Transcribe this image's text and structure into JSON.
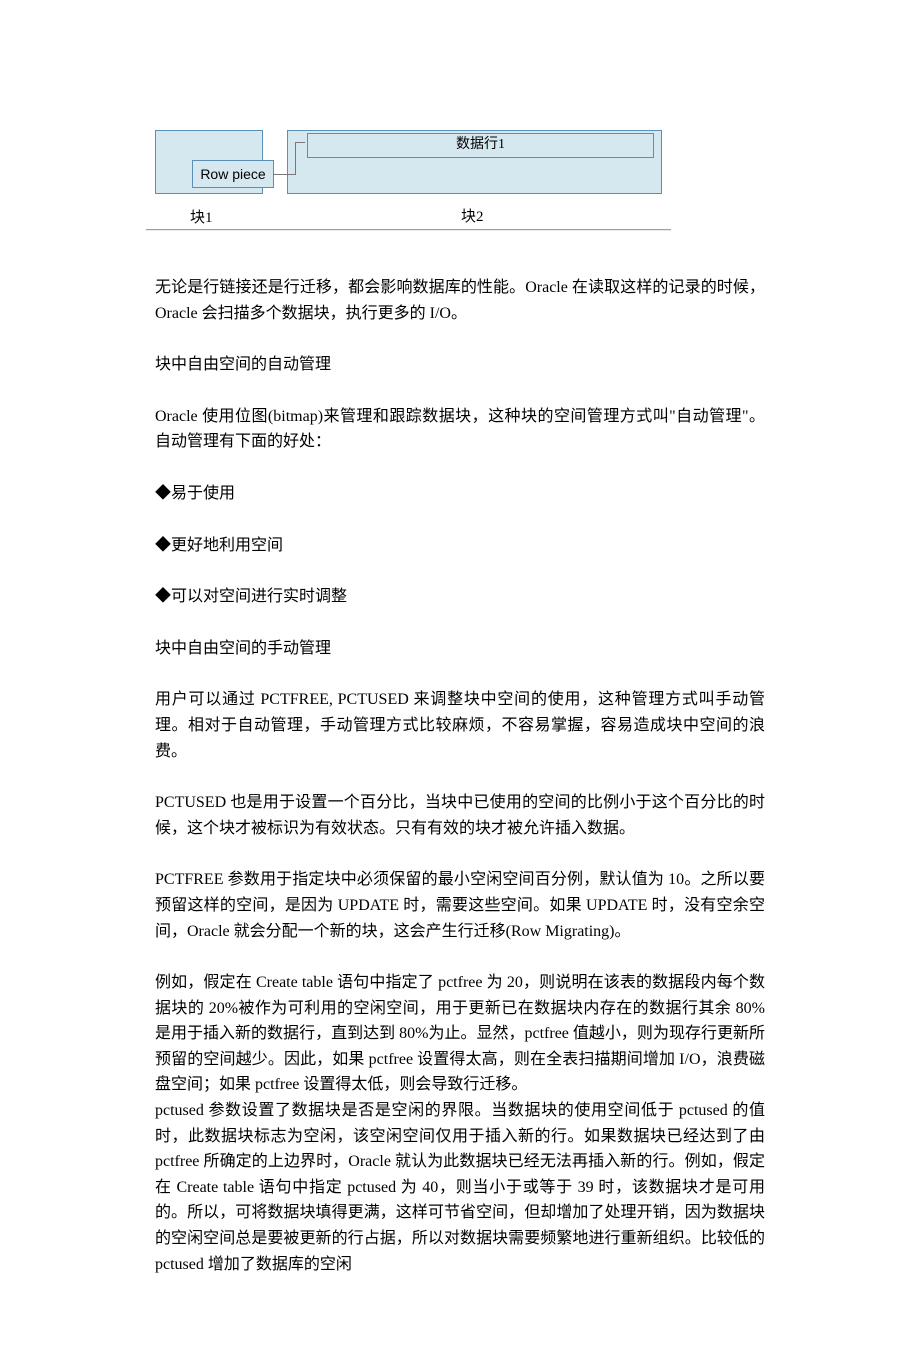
{
  "diagram": {
    "rowpiece_label": "Row piece",
    "datarow_label": "数据行1",
    "block1_label": "块1",
    "block2_label": "块2"
  },
  "p1": "无论是行链接还是行迁移，都会影响数据库的性能。Oracle 在读取这样的记录的时候，Oracle 会扫描多个数据块，执行更多的 I/O。",
  "h1": "块中自由空间的自动管理",
  "p2": "Oracle 使用位图(bitmap)来管理和跟踪数据块，这种块的空间管理方式叫\"自动管理\"。自动管理有下面的好处：",
  "b1": "◆易于使用",
  "b2": "◆更好地利用空间",
  "b3": "◆可以对空间进行实时调整",
  "h2": "块中自由空间的手动管理",
  "p3": "用户可以通过 PCTFREE, PCTUSED 来调整块中空间的使用，这种管理方式叫手动管理。相对于自动管理，手动管理方式比较麻烦，不容易掌握，容易造成块中空间的浪费。",
  "p4": "PCTUSED 也是用于设置一个百分比，当块中已使用的空间的比例小于这个百分比的时候，这个块才被标识为有效状态。只有有效的块才被允许插入数据。",
  "p5": "PCTFREE 参数用于指定块中必须保留的最小空闲空间百分例，默认值为 10。之所以要预留这样的空间，是因为 UPDATE 时，需要这些空间。如果 UPDATE 时，没有空余空间，Oracle 就会分配一个新的块，这会产生行迁移(Row Migrating)。",
  "p6": "例如，假定在 Create table 语句中指定了 pctfree 为 20，则说明在该表的数据段内每个数据块的 20%被作为可利用的空闲空间，用于更新已在数据块内存在的数据行其余 80%是用于插入新的数据行，直到达到 80%为止。显然，pctfree 值越小，则为现存行更新所预留的空间越少。因此，如果 pctfree 设置得太高，则在全表扫描期间增加 I/O，浪费磁盘空间；如果 pctfree 设置得太低，则会导致行迁移。",
  "p7": "pctused 参数设置了数据块是否是空闲的界限。当数据块的使用空间低于 pctused 的值时，此数据块标志为空闲，该空闲空间仅用于插入新的行。如果数据块已经达到了由 pctfree 所确定的上边界时，Oracle 就认为此数据块已经无法再插入新的行。例如，假定在 Create table 语句中指定 pctused 为 40，则当小于或等于 39 时，该数据块才是可用的。所以，可将数据块填得更满，这样可节省空间，但却增加了处理开销，因为数据块的空闲空间总是要被更新的行占据，所以对数据块需要频繁地进行重新组织。比较低的 pctused 增加了数据库的空闲"
}
